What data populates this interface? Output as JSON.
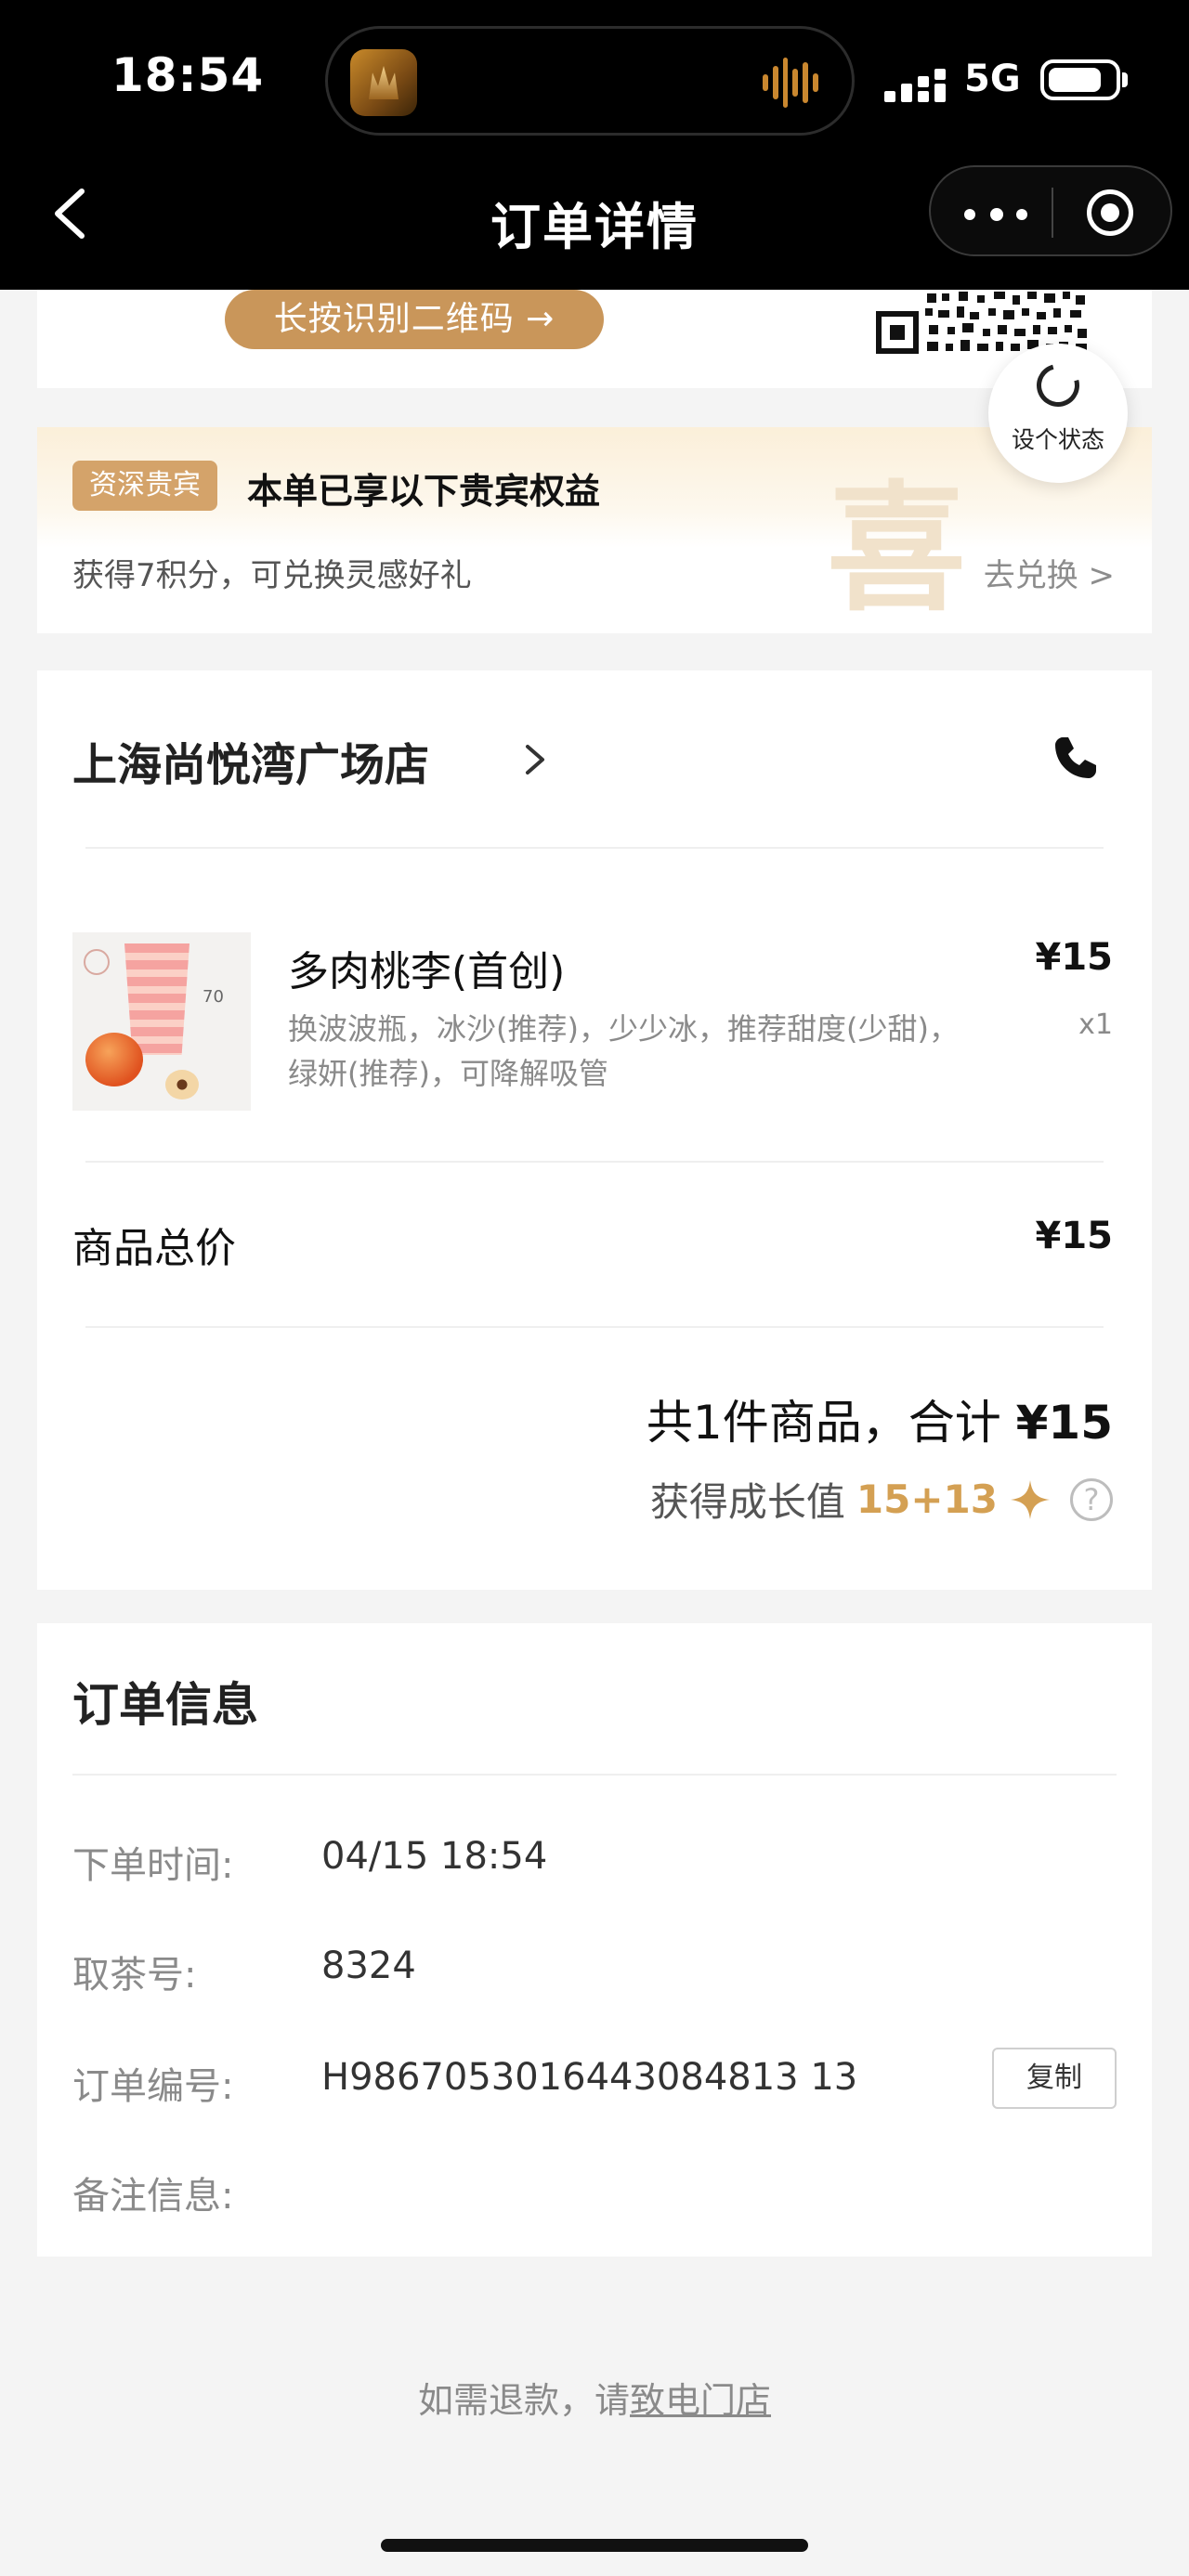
{
  "status_bar": {
    "time": "18:54",
    "network": "5G"
  },
  "header": {
    "title": "订单详情"
  },
  "qr_card": {
    "button_label": "长按识别二维码 →"
  },
  "status_bubble": {
    "label": "设个状态"
  },
  "vip": {
    "badge": "资深贵宾",
    "title": "本单已享以下贵宾权益",
    "points_text": "获得7积分，可兑换灵感好礼",
    "redeem_link": "去兑换 >",
    "watermark": "喜"
  },
  "store": {
    "name": "上海尚悦湾广场店"
  },
  "product": {
    "name": "多肉桃李(首创)",
    "options_line1": "换波波瓶，冰沙(推荐)，少少冰，推荐甜度(少甜)，",
    "options_line2": "绿妍(推荐)，可降解吸管",
    "price": "¥15",
    "qty": "x1",
    "image_badge_text": "70"
  },
  "summary": {
    "subtotal_label": "商品总价",
    "subtotal_value": "¥15",
    "total_prefix": "共1件商品，合计",
    "total_amount": "¥15",
    "growth_label": "获得成长值",
    "growth_value": "15+13"
  },
  "order_info": {
    "title": "订单信息",
    "rows": [
      {
        "label": "下单时间:",
        "value": "04/15 18:54"
      },
      {
        "label": "取茶号:",
        "value": "8324"
      },
      {
        "label": "订单编号:",
        "value": "H9867053016443084813 13"
      },
      {
        "label": "备注信息:",
        "value": ""
      }
    ],
    "copy_label": "复制"
  },
  "footer": {
    "refund_prefix": "如需退款，请",
    "refund_link": "致电门店"
  },
  "colors": {
    "accent_gold": "#c9965a",
    "growth_gold": "#d4a053",
    "header_bg": "#000000"
  }
}
